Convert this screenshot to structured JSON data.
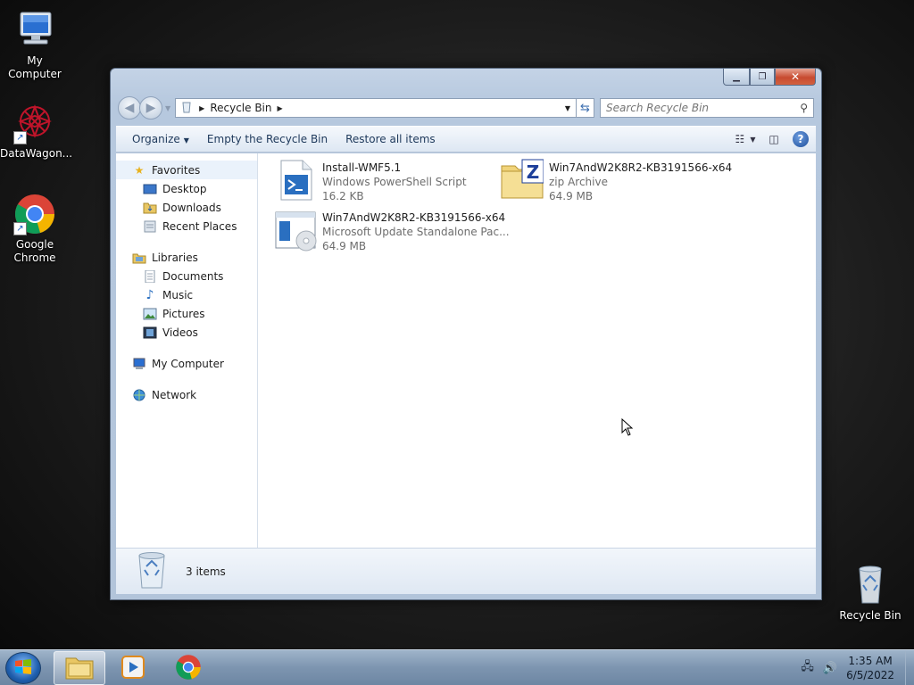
{
  "desktop": {
    "icons": [
      {
        "label": "My Computer"
      },
      {
        "label": "DataWagon..."
      },
      {
        "label": "Google Chrome"
      },
      {
        "label": "Recycle Bin"
      }
    ]
  },
  "window": {
    "address": {
      "crumb": "Recycle Bin"
    },
    "search": {
      "placeholder": "Search Recycle Bin"
    },
    "toolbar": {
      "organize": "Organize",
      "empty": "Empty the Recycle Bin",
      "restore": "Restore all items"
    },
    "nav": {
      "favorites": {
        "label": "Favorites",
        "items": [
          "Desktop",
          "Downloads",
          "Recent Places"
        ]
      },
      "libraries": {
        "label": "Libraries",
        "items": [
          "Documents",
          "Music",
          "Pictures",
          "Videos"
        ]
      },
      "computer": {
        "label": "My Computer"
      },
      "network": {
        "label": "Network"
      }
    },
    "files": [
      {
        "name": "Install-WMF5.1",
        "type": "Windows PowerShell Script",
        "size": "16.2 KB",
        "icon": "powershell-script-icon"
      },
      {
        "name": "Win7AndW2K8R2-KB3191566-x64",
        "type": "zip Archive",
        "size": "64.9 MB",
        "icon": "zip-archive-icon"
      },
      {
        "name": "Win7AndW2K8R2-KB3191566-x64",
        "type": "Microsoft Update Standalone Pac...",
        "size": "64.9 MB",
        "icon": "msu-package-icon"
      }
    ],
    "details": {
      "count": "3 items"
    }
  },
  "taskbar": {
    "clock": {
      "time": "1:35 AM",
      "date": "6/5/2022"
    }
  },
  "colors": {
    "accent": "#1f5fae",
    "close": "#c74b30"
  }
}
